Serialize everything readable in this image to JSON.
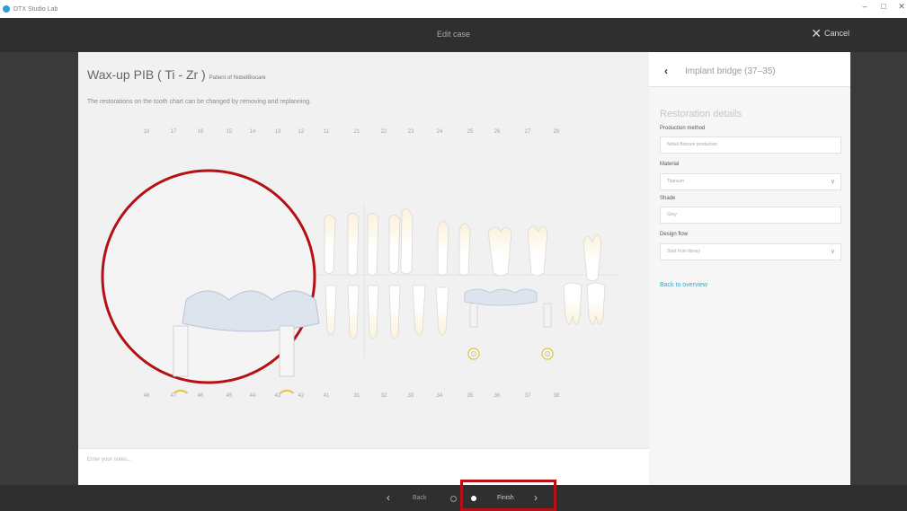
{
  "window": {
    "app_name": "DTX Studio Lab",
    "controls": [
      "–",
      "□",
      "✕"
    ]
  },
  "header": {
    "title": "Edit case",
    "cancel_label": "Cancel"
  },
  "case": {
    "title": "Wax-up PIB ( Ti - Zr )",
    "patient": "Patient of NobelBiocare",
    "description": "The restorations on the tooth chart can be changed by removing and replanning."
  },
  "tooth_chart": {
    "upper_numbers": [
      "18",
      "17",
      "16",
      "15",
      "14",
      "13",
      "12",
      "11",
      "21",
      "22",
      "23",
      "24",
      "25",
      "26",
      "27",
      "28"
    ],
    "lower_numbers": [
      "48",
      "47",
      "46",
      "45",
      "44",
      "43",
      "42",
      "41",
      "31",
      "32",
      "33",
      "34",
      "35",
      "36",
      "37",
      "38"
    ]
  },
  "notes": {
    "placeholder": "Enter your notes..."
  },
  "restoration_panel": {
    "back_icon": "chevron-left-icon",
    "header_label": "Implant bridge (37–35)",
    "section_title": "Restoration details",
    "production_method": {
      "label": "Production method",
      "value": "Nobel Biocare production"
    },
    "material": {
      "label": "Material",
      "value": "Titanium"
    },
    "shade": {
      "label": "Shade",
      "value": "Grey"
    },
    "design_flow": {
      "label": "Design flow",
      "value": "Start from library"
    },
    "back_to_overview": "Back to overview"
  },
  "footer": {
    "back_label": "Back",
    "finish_label": "Finish"
  },
  "colors": {
    "accent": "#3da7c5",
    "highlight": "#b41016",
    "topbar": "#2f2f2f"
  }
}
